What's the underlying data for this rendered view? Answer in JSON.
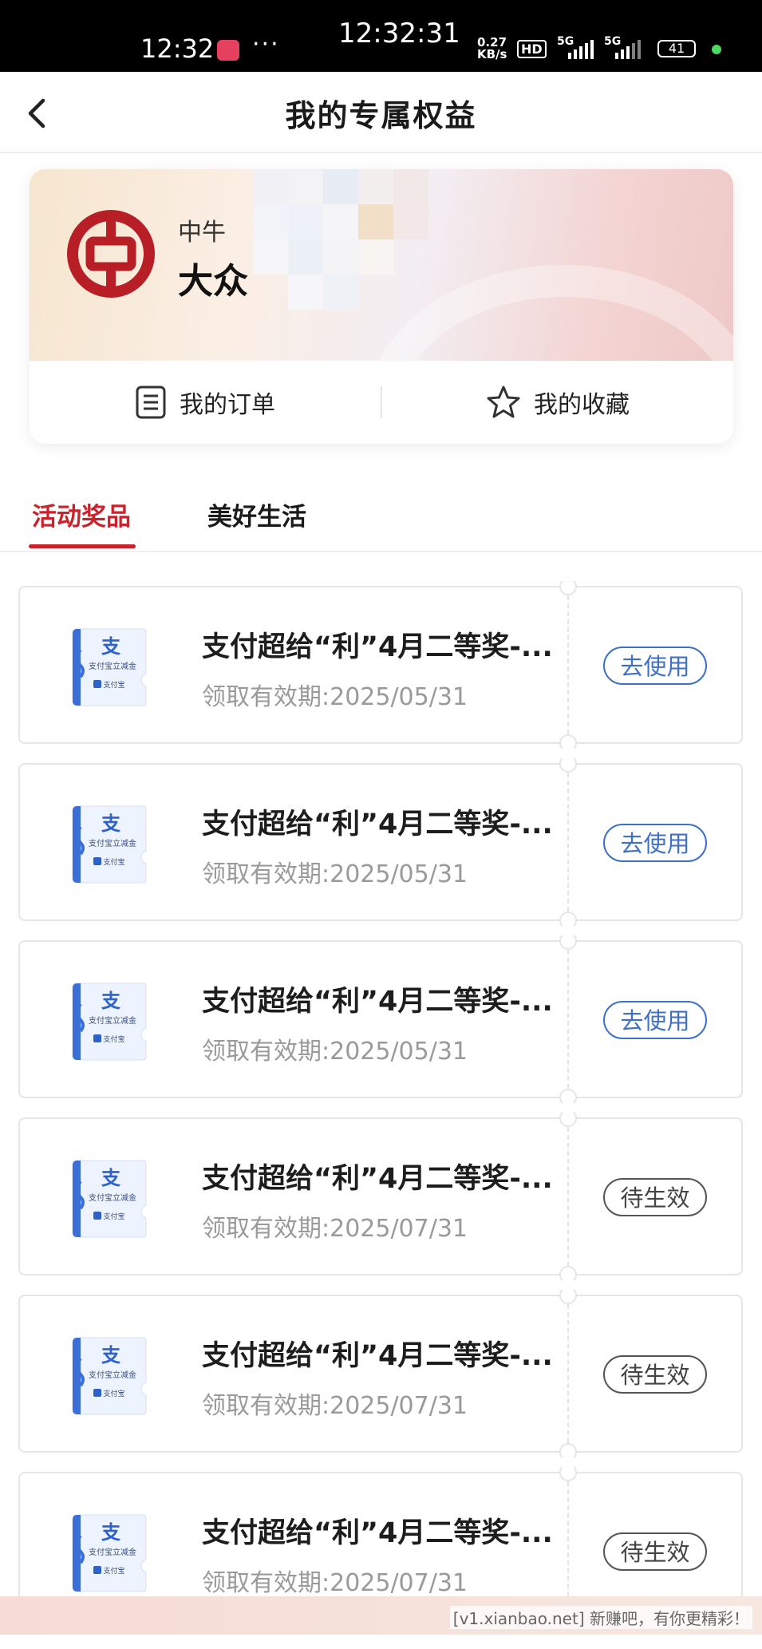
{
  "status_bar": {
    "time": "12:32",
    "center_time": "12:32:31",
    "more": "···",
    "net_speed_value": "0.27",
    "net_speed_unit": "KB/s",
    "hd": "HD",
    "sig1": "5G",
    "sig2": "5G",
    "battery": "41"
  },
  "nav": {
    "title": "我的专属权益"
  },
  "bank_card": {
    "subtitle": "中牛",
    "name": "大众",
    "actions": [
      {
        "label": "我的订单",
        "icon": "document-list-icon"
      },
      {
        "label": "我的收藏",
        "icon": "star-icon"
      }
    ]
  },
  "tabs": [
    {
      "label": "活动奖品",
      "active": true
    },
    {
      "label": "美好生活",
      "active": false
    }
  ],
  "coupons": [
    {
      "title": "支付超给“利”4月二等奖-...",
      "date": "领取有效期:2025/05/31",
      "action": "去使用",
      "status": "use"
    },
    {
      "title": "支付超给“利”4月二等奖-...",
      "date": "领取有效期:2025/05/31",
      "action": "去使用",
      "status": "use"
    },
    {
      "title": "支付超给“利”4月二等奖-...",
      "date": "领取有效期:2025/05/31",
      "action": "去使用",
      "status": "use"
    },
    {
      "title": "支付超给“利”4月二等奖-...",
      "date": "领取有效期:2025/07/31",
      "action": "待生效",
      "status": "pending"
    },
    {
      "title": "支付超给“利”4月二等奖-...",
      "date": "领取有效期:2025/07/31",
      "action": "待生效",
      "status": "pending"
    },
    {
      "title": "支付超给“利”4月二等奖-...",
      "date": "领取有效期:2025/07/31",
      "action": "待生效",
      "status": "pending"
    }
  ],
  "coupon_thumb": {
    "glyph": "支",
    "caption": "支付宝立减金",
    "brand": "支付宝"
  },
  "watermark": "[v1.xianbao.net] 新赚吧，有你更精彩！",
  "colors": {
    "accent": "#c8232c",
    "use_button": "#3f70c8",
    "pending_button": "#555555"
  }
}
